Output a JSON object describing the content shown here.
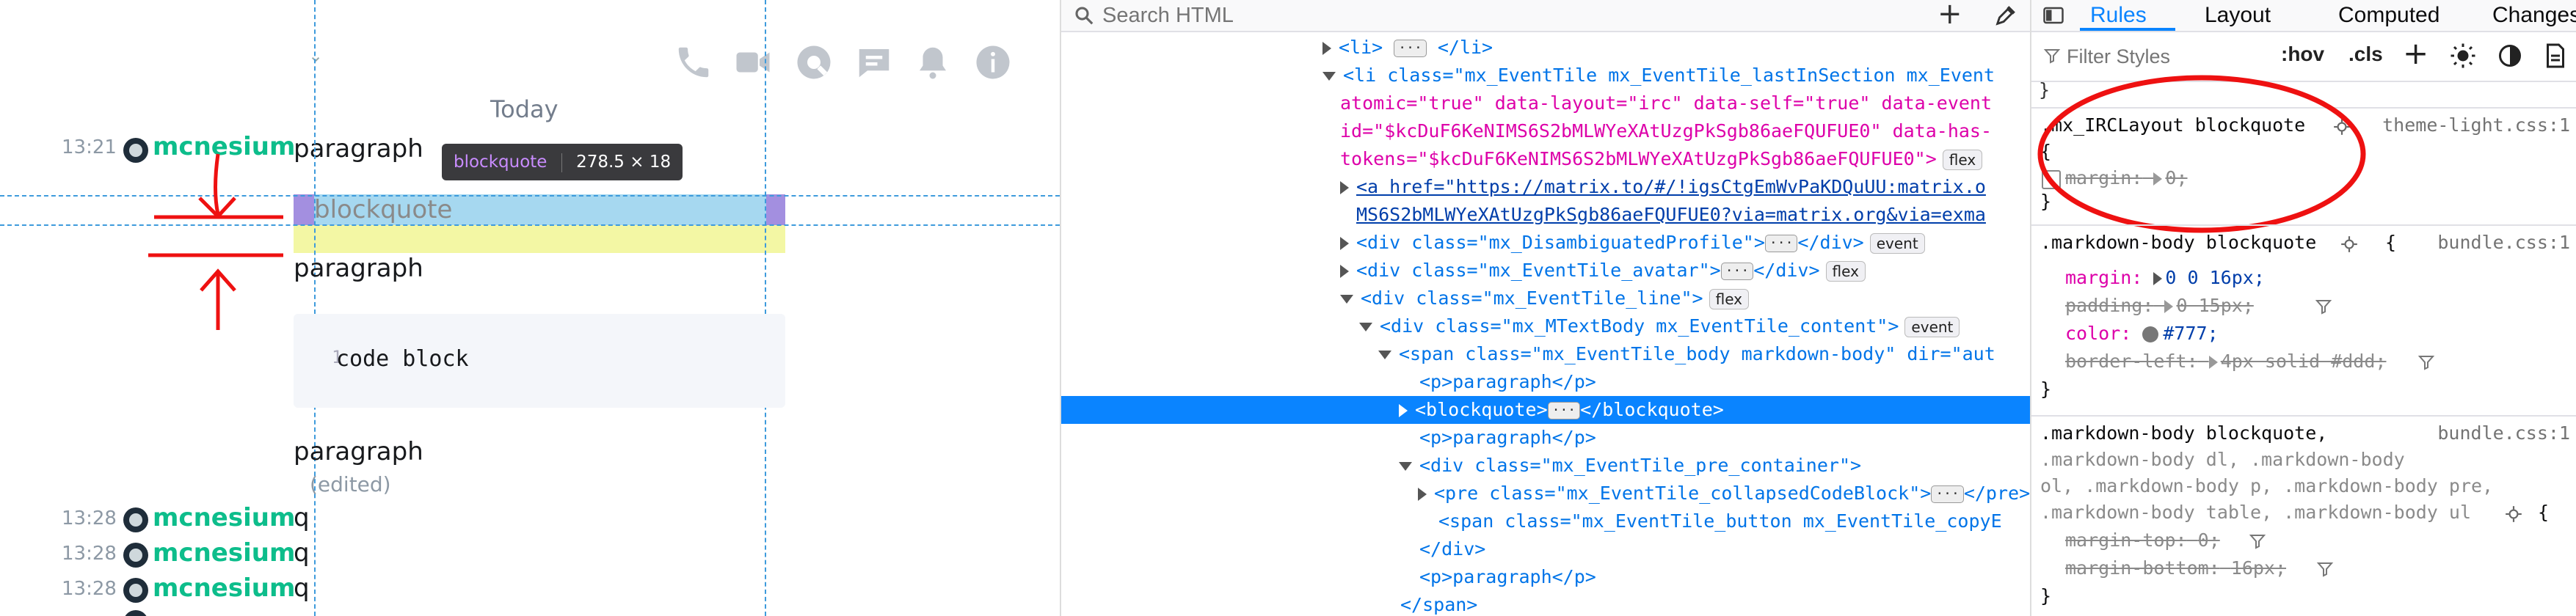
{
  "chat": {
    "date_separator": "Today",
    "header_icons": [
      "phone-icon",
      "video-icon",
      "threads-icon",
      "chat-icon",
      "bell-icon",
      "info-icon"
    ],
    "highlight_tooltip": {
      "name": "blockquote",
      "size": "278.5 × 18"
    },
    "messages": [
      {
        "time": "13:21",
        "sender": "mcnesium",
        "body": "paragraph"
      }
    ],
    "blockquote_text": "blockquote",
    "paragraph2": "paragraph",
    "code_text": "code block",
    "paragraph3": "paragraph",
    "edited": "(edited)",
    "later_messages": [
      {
        "time": "13:28",
        "sender": "mcnesium",
        "body": "q"
      },
      {
        "time": "13:28",
        "sender": "mcnesium",
        "body": "q"
      },
      {
        "time": "13:28",
        "sender": "mcnesium",
        "body": "q"
      }
    ],
    "colors": {
      "sender": "#0dbd8b",
      "blockquote_bg": "#a6d8f0",
      "padding_bg": "#f3f7a4",
      "guide": "#3e9bdc",
      "annotation": "#ee1111"
    }
  },
  "inspector": {
    "search_placeholder": "Search HTML",
    "lines": [
      {
        "t": "<li>",
        "rest": " </li>"
      },
      {
        "a": "<li class=\"mx_EventTile mx_EventTile_lastInSection mx_Event"
      },
      {
        "a": "atomic=\"true\" data-layout=\"irc\" data-self=\"true\" data-event"
      },
      {
        "a": "id=\"$kcDuF6KeNIMS6S2bMLWYeXAtUzgPkSgb86aeFQUFUE0\" data-has-"
      },
      {
        "a": "tokens=\"$kcDuF6KeNIMS6S2bMLWYeXAtUzgPkSgb86aeFQUFUE0\">",
        "badge": "flex"
      },
      {
        "a": "<a href=\"https://matrix.to/#/!igsCtgEmWvPaKDQuUU:matrix.o"
      },
      {
        "a": "MS6S2bMLWYeXAtUzgPkSgb86aeFQUFUE0?via=matrix.org&via=exma"
      },
      {
        "a": "<div class=\"mx_DisambiguatedProfile\">",
        "b": "</div>",
        "badge": "event"
      },
      {
        "a": "<div class=\"mx_EventTile_avatar\">",
        "b": "</div>",
        "badge": "flex"
      },
      {
        "a": "<div class=\"mx_EventTile_line\">",
        "badge": "flex"
      },
      {
        "a": "<div class=\"mx_MTextBody mx_EventTile_content\">",
        "badge": "event"
      },
      {
        "a": "<span class=\"mx_EventTile_body markdown-body\" dir=\"aut"
      },
      {
        "a": "<p>paragraph</p>"
      },
      {
        "a": "<blockquote>",
        "b": "</blockquote>"
      },
      {
        "a": "<p>paragraph</p>"
      },
      {
        "a": "<div class=\"mx_EventTile_pre_container\">"
      },
      {
        "a": "<pre class=\"mx_EventTile_collapsedCodeBlock\">",
        "b": "</pre>"
      },
      {
        "a": "<span class=\"mx_EventTile_button mx_EventTile_copyE"
      },
      {
        "a": "</div>"
      },
      {
        "a": "<p>paragraph</p>"
      },
      {
        "a": "</span>"
      }
    ]
  },
  "rules": {
    "tabs": [
      "Rules",
      "Layout",
      "Computed",
      "Changes"
    ],
    "filter_placeholder": "Filter Styles",
    "hov": ":hov",
    "cls": ".cls",
    "rule1": {
      "selector": ".mx_IRCLayout blockquote",
      "source": "theme-light.css:1",
      "brace_open": "{",
      "prop": "margin:",
      "value": "0;",
      "brace_close": "}"
    },
    "rule2": {
      "selector": ".markdown-body blockquote",
      "brace_open": "{",
      "source": "bundle.css:1",
      "p1": "margin:",
      "v1": "0 0 16px;",
      "p2": "padding:",
      "v2": "0 15px;",
      "p3": "color:",
      "v3": "#777;",
      "p4": "border-left:",
      "v4": "4px solid #ddd;",
      "brace_close": "}"
    },
    "rule3": {
      "sel1": ".markdown-body blockquote,",
      "source": "bundle.css:1",
      "sel2": ".markdown-body dl, .markdown-body",
      "sel3": "ol, .markdown-body p, .markdown-body pre,",
      "sel4": ".markdown-body table, .markdown-body ul",
      "brace_open": "{",
      "p1": "margin-top:",
      "v1": "0;",
      "p2": "margin-bottom:",
      "v2": "16px;",
      "brace_close": "}"
    },
    "colors": {
      "swatch": "#777777",
      "tab_active": "#0a84ff"
    }
  }
}
